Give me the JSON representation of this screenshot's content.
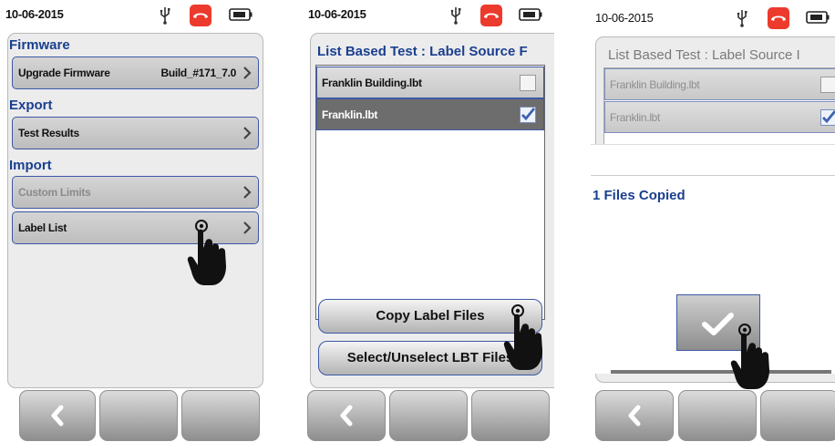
{
  "status": {
    "date": "10-06-2015"
  },
  "screen1": {
    "sections": [
      {
        "title": "Firmware",
        "rows": [
          {
            "label": "Upgrade Firmware",
            "value": "Build_#171_7.0"
          }
        ]
      },
      {
        "title": "Export",
        "rows": [
          {
            "label": "Test Results"
          }
        ]
      },
      {
        "title": "Import",
        "rows": [
          {
            "label": "Custom Limits",
            "disabled": true
          },
          {
            "label": "Label List"
          }
        ]
      }
    ]
  },
  "screen2": {
    "title": "List Based Test : Label Source F",
    "files": [
      {
        "name": "Franklin Building.lbt",
        "checked": false
      },
      {
        "name": "Franklin.lbt",
        "checked": true
      }
    ],
    "copy_button": "Copy Label Files",
    "select_button": "Select/Unselect LBT Files"
  },
  "screen3": {
    "title": "List Based Test : Label Source I",
    "files": [
      {
        "name": "Franklin Building.lbt",
        "checked": false
      },
      {
        "name": "Franklin.lbt",
        "checked": true
      }
    ],
    "message": "1 Files Copied"
  },
  "colors": {
    "accent": "#1a3f8f",
    "phone_red": "#ec3a2d",
    "selected_row": "#6d6d6d"
  },
  "icons": [
    "usb-icon",
    "phone-hangup-icon",
    "battery-icon",
    "chevron-right-icon",
    "back-arrow-icon",
    "checkmark-icon",
    "pointing-hand-icon"
  ]
}
